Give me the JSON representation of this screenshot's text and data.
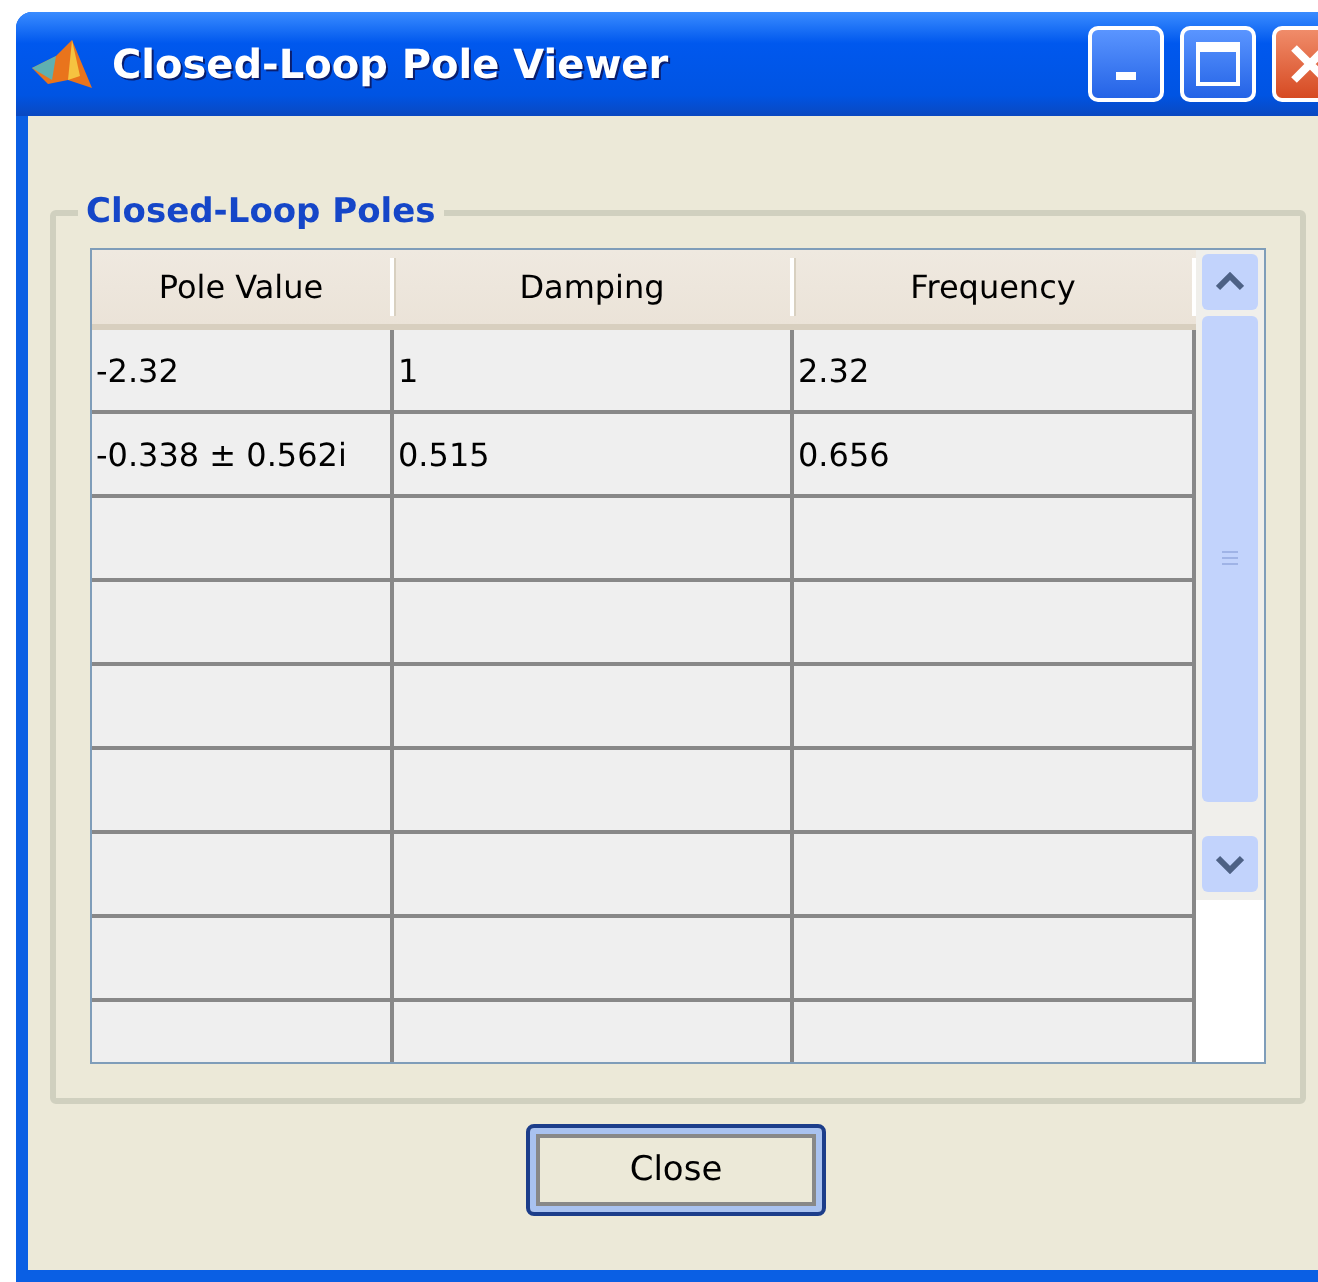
{
  "window": {
    "title": "Closed-Loop Pole Viewer"
  },
  "group": {
    "title": "Closed-Loop Poles"
  },
  "table": {
    "columns": [
      "Pole Value",
      "Damping",
      "Frequency"
    ],
    "rows": [
      [
        "-2.32",
        "1",
        "2.32"
      ],
      [
        "-0.338 ± 0.562i",
        "0.515",
        "0.656"
      ]
    ]
  },
  "buttons": [
    {
      "label": "Close",
      "kind": "default"
    }
  ]
}
